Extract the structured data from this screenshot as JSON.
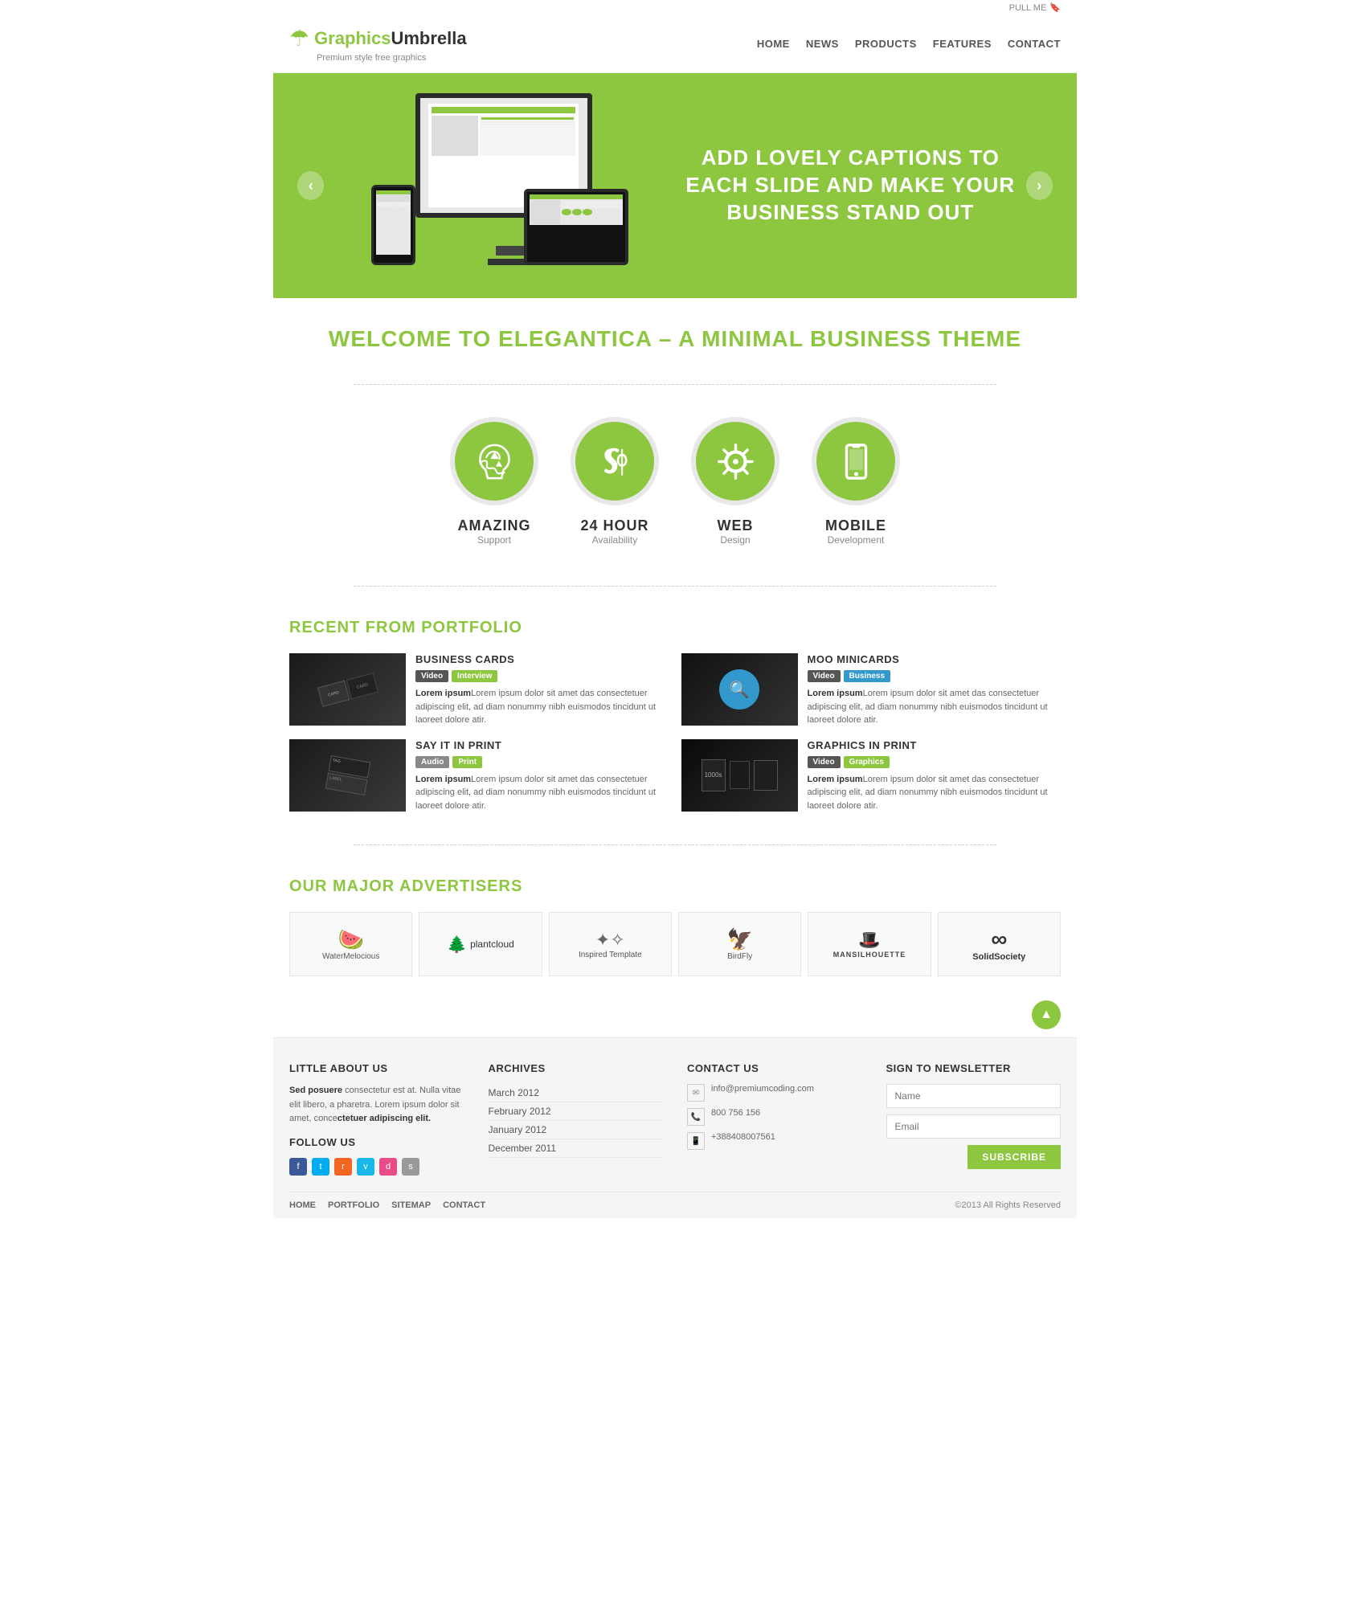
{
  "header": {
    "logo": {
      "graphics": "Graphics",
      "umbrella": "Umbrella",
      "tagline": "Premium style free graphics"
    },
    "pull_me": "PULL ME",
    "nav": {
      "items": [
        {
          "label": "HOME",
          "id": "nav-home"
        },
        {
          "label": "NEWS",
          "id": "nav-news"
        },
        {
          "label": "PRODUCTS",
          "id": "nav-products"
        },
        {
          "label": "FEATURES",
          "id": "nav-features"
        },
        {
          "label": "CONTACT",
          "id": "nav-contact"
        }
      ]
    }
  },
  "slider": {
    "heading": "ADD LOVELY CAPTIONS TO EACH SLIDE AND MAKE YOUR BUSINESS STAND OUT",
    "prev_label": "‹",
    "next_label": "›"
  },
  "welcome": {
    "prefix": "WELCOME TO ",
    "brand": "ELEGANTICA",
    "suffix": " – A MINIMAL BUSINESS THEME"
  },
  "features": [
    {
      "id": "amazing",
      "title": "AMAZING",
      "subtitle": "Support",
      "icon": "recycle"
    },
    {
      "id": "24hour",
      "title": "24 HOUR",
      "subtitle": "Availability",
      "icon": "phone"
    },
    {
      "id": "web",
      "title": "WEB",
      "subtitle": "Design",
      "icon": "gear"
    },
    {
      "id": "mobile",
      "title": "MOBILE",
      "subtitle": "Development",
      "icon": "mobile"
    }
  ],
  "portfolio": {
    "title": "RECENT FROM ",
    "title_highlight": "PORTFOLIO",
    "items": [
      {
        "id": "business-cards",
        "title": "BUSINESS CARDS",
        "tags": [
          {
            "label": "Video",
            "class": "tag-video"
          },
          {
            "label": "Interview",
            "class": "tag-interview"
          }
        ],
        "text": "Lorem ipsum dolor sit amet das consectetuer adipiscing elit, ad diam nonummy nibh euismodos tincidunt ut laoreet dolore atir."
      },
      {
        "id": "moo-minicards",
        "title": "MOO MINICARDS",
        "tags": [
          {
            "label": "Video",
            "class": "tag-video"
          },
          {
            "label": "Business",
            "class": "tag-business"
          }
        ],
        "text": "Lorem ipsum dolor sit amet das consectetuer adipiscing elit, ad diam nonummy nibh euismodos tincidunt ut laoreet dolore atir."
      },
      {
        "id": "say-it-in-print",
        "title": "SAY IT IN PRINT",
        "tags": [
          {
            "label": "Audio",
            "class": "tag-audio"
          },
          {
            "label": "Print",
            "class": "tag-print"
          }
        ],
        "text": "Lorem ipsum dolor sit amet das consectetuer adipiscing elit, ad diam nonummy nibh euismodos tincidunt ut laoreet dolore atir."
      },
      {
        "id": "graphics-in-print",
        "title": "GRAPHICS IN PRINT",
        "tags": [
          {
            "label": "Video",
            "class": "tag-video"
          },
          {
            "label": "Graphics",
            "class": "tag-graphics"
          }
        ],
        "text": "Lorem ipsum dolor sit amet das consectetuer adipiscing elit, ad diam nonummy nibh euismodos tincidunt ut laoreet dolore atir."
      }
    ]
  },
  "advertisers": {
    "title": "OUR MAJOR ",
    "title_highlight": "ADVERTISERS",
    "items": [
      {
        "id": "watermelocious",
        "label": "WaterMelocious",
        "symbol": "🍉"
      },
      {
        "id": "plantcloud",
        "label": "plantcloud",
        "symbol": "🌳"
      },
      {
        "id": "inspired-template",
        "label": "Inspired Template",
        "symbol": "✦"
      },
      {
        "id": "birdfly",
        "label": "BirdFly",
        "symbol": "🦅"
      },
      {
        "id": "man-silhouette",
        "label": "MANSILHOUETTE",
        "symbol": "🎩"
      },
      {
        "id": "solid-society",
        "label": "SolidSociety",
        "symbol": "∞"
      }
    ]
  },
  "footer": {
    "about": {
      "title": "LITTLE ABOUT US",
      "text_bold": "Sed posuere",
      "text": " consectetur est at. Nulla vitae elit libero, a pharetra. Lorem ipsum dolor sit amet, conce",
      "text_bold2": "ctetuer adipiscing elit.",
      "follow_title": "FOLLOW US",
      "social": [
        "f",
        "t",
        "rss",
        "v",
        "d",
        "s"
      ]
    },
    "archives": {
      "title": "ARCHIVES",
      "items": [
        {
          "label": "March 2012",
          "id": "arch-mar"
        },
        {
          "label": "February 2012",
          "id": "arch-feb"
        },
        {
          "label": "January 2012",
          "id": "arch-jan"
        },
        {
          "label": "December 2011",
          "id": "arch-dec"
        }
      ]
    },
    "contact": {
      "title": "CONTACT US",
      "email": "info@premiumcoding.com",
      "phone": "800 756 156",
      "mobile": "+388408007561"
    },
    "newsletter": {
      "title": "SIGN TO NEWSLETTER",
      "name_placeholder": "Name",
      "email_placeholder": "Email",
      "subscribe_label": "SUBSCRIBE"
    },
    "bottom_nav": [
      {
        "label": "HOME"
      },
      {
        "label": "PORTFOLIO"
      },
      {
        "label": "SITEMAP"
      },
      {
        "label": "CONTACT"
      }
    ],
    "copyright": "©2013 All Rights Reserved"
  }
}
